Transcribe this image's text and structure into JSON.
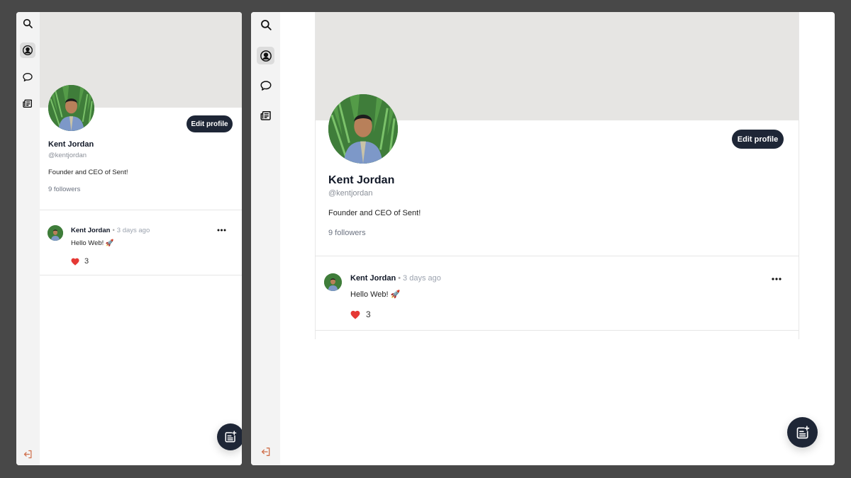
{
  "colors": {
    "background": "#484848",
    "accent_dark": "#1e2636",
    "cover": "#e6e5e3",
    "heart": "#e53935",
    "logout": "#d0704c"
  },
  "nav": {
    "items": [
      {
        "name": "search",
        "icon": "search-icon"
      },
      {
        "name": "profile",
        "icon": "user-circle-icon",
        "active": true
      },
      {
        "name": "messages",
        "icon": "chat-bubble-icon"
      },
      {
        "name": "news",
        "icon": "newspaper-icon"
      }
    ],
    "logout_icon": "logout-icon"
  },
  "profile": {
    "name": "Kent Jordan",
    "handle": "@kentjordan",
    "bio": "Founder and CEO of Sent!",
    "followers": "9 followers",
    "edit_label": "Edit profile"
  },
  "post": {
    "author": "Kent Jordan",
    "separator": "•",
    "time": "3 days ago",
    "text": "Hello Web! 🚀",
    "likes": "3",
    "more_icon": "more-horizontal-icon"
  },
  "fab": {
    "icon": "new-post-icon"
  }
}
